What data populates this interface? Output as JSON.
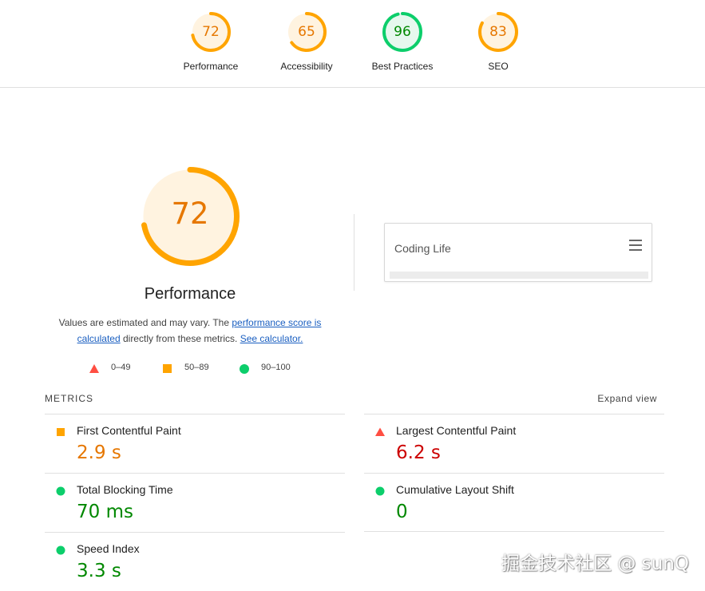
{
  "colors": {
    "average": "#ffa400",
    "average_text": "#e67700",
    "average_fill": "#fff3e0",
    "pass": "#0cce6b",
    "pass_text": "#008800",
    "pass_fill": "#e6f8ee",
    "fail": "#ff4e42",
    "fail_text": "#cc0000",
    "link": "#1a5fc1"
  },
  "categories": [
    {
      "score": "72",
      "value": 72,
      "label": "Performance",
      "status": "average"
    },
    {
      "score": "65",
      "value": 65,
      "label": "Accessibility",
      "status": "average"
    },
    {
      "score": "96",
      "value": 96,
      "label": "Best Practices",
      "status": "pass"
    },
    {
      "score": "83",
      "value": 83,
      "label": "SEO",
      "status": "average"
    }
  ],
  "main": {
    "score": "72",
    "value": 72,
    "title": "Performance",
    "desc_prefix": "Values are estimated and may vary. The ",
    "desc_link1": "performance score is calculated",
    "desc_middle": " directly from these metrics. ",
    "desc_link2": "See calculator."
  },
  "legend": [
    {
      "icon": "red-triangle-icon",
      "label": "0–49"
    },
    {
      "icon": "orange-square-icon",
      "label": "50–89"
    },
    {
      "icon": "green-circle-icon",
      "label": "90–100"
    }
  ],
  "screenshot": {
    "site_title": "Coding Life",
    "menu_icon": "hamburger-menu-icon"
  },
  "metrics": {
    "heading": "METRICS",
    "expand_label": "Expand view",
    "items": [
      {
        "name": "First Contentful Paint",
        "value": "2.9 s",
        "status": "average"
      },
      {
        "name": "Largest Contentful Paint",
        "value": "6.2 s",
        "status": "fail"
      },
      {
        "name": "Total Blocking Time",
        "value": "70 ms",
        "status": "pass"
      },
      {
        "name": "Cumulative Layout Shift",
        "value": "0",
        "status": "pass"
      },
      {
        "name": "Speed Index",
        "value": "3.3 s",
        "status": "pass"
      }
    ]
  },
  "watermark": "掘金技术社区 @ sunQ"
}
